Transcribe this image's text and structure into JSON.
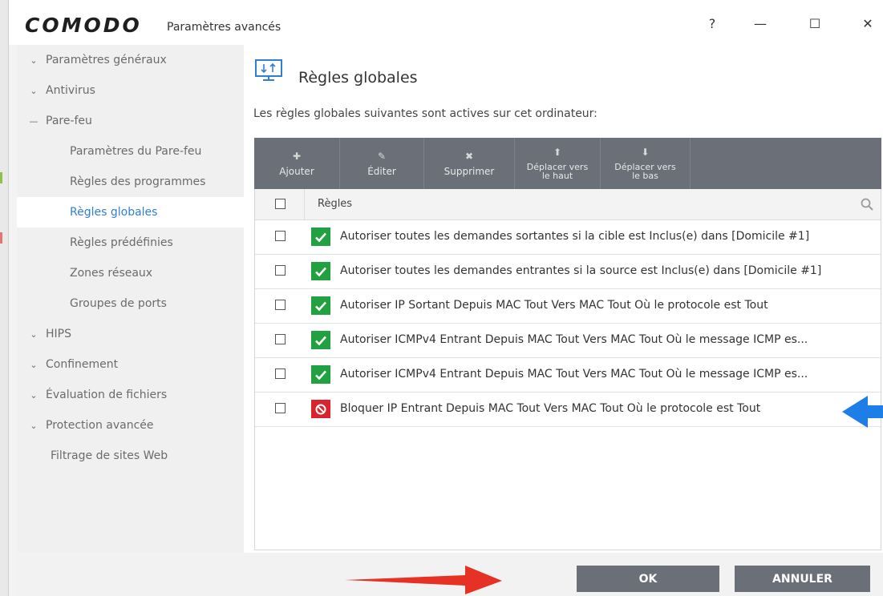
{
  "window": {
    "logo": "COMODO",
    "title": "Paramètres avancés",
    "help_label": "?",
    "minimize_label": "—",
    "maximize_label": "☐",
    "close_label": "✕"
  },
  "sidebar": {
    "items": [
      {
        "label": "Paramètres généraux",
        "chevron": "⌄"
      },
      {
        "label": "Antivirus",
        "chevron": "⌄"
      },
      {
        "label": "Pare-feu",
        "chevron": "—"
      },
      {
        "label": "Paramètres du Pare-feu"
      },
      {
        "label": "Règles des programmes"
      },
      {
        "label": "Règles globales"
      },
      {
        "label": "Règles prédéfinies"
      },
      {
        "label": "Zones réseaux"
      },
      {
        "label": "Groupes de ports"
      },
      {
        "label": "HIPS",
        "chevron": "⌄"
      },
      {
        "label": "Confinement",
        "chevron": "⌄"
      },
      {
        "label": "Évaluation de fichiers",
        "chevron": "⌄"
      },
      {
        "label": "Protection avancée",
        "chevron": "⌄"
      },
      {
        "label": "Filtrage de sites Web"
      }
    ],
    "active_index": 5
  },
  "main": {
    "title": "Règles globales",
    "description": "Les règles globales suivantes sont actives sur cet ordinateur:",
    "toolbar": {
      "add": "Ajouter",
      "edit": "Éditer",
      "delete": "Supprimer",
      "move_up_1": "Déplacer vers",
      "move_up_2": "le haut",
      "move_down_1": "Déplacer vers",
      "move_down_2": "le bas"
    },
    "table": {
      "header": "Règles",
      "rows": [
        {
          "type": "allow",
          "text": "Autoriser toutes les demandes sortantes si la cible est Inclus(e) dans [Domicile #1]"
        },
        {
          "type": "allow",
          "text": "Autoriser toutes les demandes entrantes si la source est Inclus(e) dans [Domicile #1]"
        },
        {
          "type": "allow",
          "text": "Autoriser IP Sortant Depuis MAC Tout Vers MAC Tout Où le protocole est Tout"
        },
        {
          "type": "allow",
          "text": "Autoriser ICMPv4 Entrant Depuis MAC Tout Vers MAC Tout Où le message ICMP es..."
        },
        {
          "type": "allow",
          "text": "Autoriser ICMPv4 Entrant Depuis MAC Tout Vers MAC Tout Où le message ICMP es..."
        },
        {
          "type": "block",
          "text": "Bloquer IP Entrant Depuis MAC Tout Vers MAC Tout Où le protocole est Tout"
        }
      ]
    }
  },
  "footer": {
    "ok": "OK",
    "cancel": "ANNULER"
  },
  "colors": {
    "accent": "#2f7fd6",
    "toolbar": "#6b6f78",
    "allow": "#21a140",
    "block": "#d9232d",
    "arrow_red": "#e53224",
    "arrow_blue": "#1e7ee8"
  }
}
